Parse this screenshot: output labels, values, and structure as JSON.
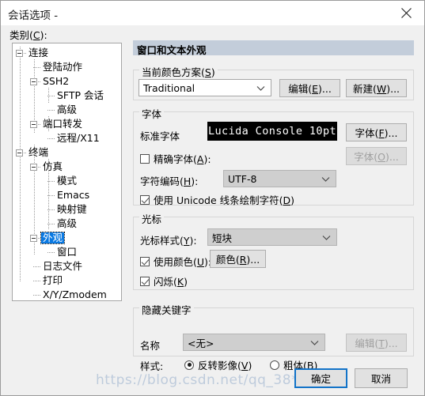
{
  "window": {
    "title": "会话选项 -",
    "close_icon": "close-icon"
  },
  "sidebar": {
    "label": "类别(C):",
    "label_main": "类别",
    "items": [
      {
        "label": "连接",
        "depth": 0,
        "expander": true,
        "selected": false
      },
      {
        "label": "登陆动作",
        "depth": 1,
        "expander": false,
        "selected": false
      },
      {
        "label": "SSH2",
        "depth": 1,
        "expander": true,
        "selected": false
      },
      {
        "label": "SFTP 会话",
        "depth": 2,
        "expander": false,
        "selected": false
      },
      {
        "label": "高级",
        "depth": 2,
        "expander": false,
        "selected": false
      },
      {
        "label": "端口转发",
        "depth": 1,
        "expander": true,
        "selected": false
      },
      {
        "label": "远程/X11",
        "depth": 2,
        "expander": false,
        "selected": false
      },
      {
        "label": "终端",
        "depth": 0,
        "expander": true,
        "selected": false
      },
      {
        "label": "仿真",
        "depth": 1,
        "expander": true,
        "selected": false
      },
      {
        "label": "模式",
        "depth": 2,
        "expander": false,
        "selected": false
      },
      {
        "label": "Emacs",
        "depth": 2,
        "expander": false,
        "selected": false
      },
      {
        "label": "映射键",
        "depth": 2,
        "expander": false,
        "selected": false
      },
      {
        "label": "高级",
        "depth": 2,
        "expander": false,
        "selected": false
      },
      {
        "label": "外观",
        "depth": 1,
        "expander": true,
        "selected": true
      },
      {
        "label": "窗口",
        "depth": 2,
        "expander": false,
        "selected": false
      },
      {
        "label": "日志文件",
        "depth": 1,
        "expander": false,
        "selected": false
      },
      {
        "label": "打印",
        "depth": 1,
        "expander": false,
        "selected": false
      },
      {
        "label": "X/Y/Zmodem",
        "depth": 1,
        "expander": false,
        "selected": false
      }
    ]
  },
  "main": {
    "header": "窗口和文本外观",
    "color_scheme": {
      "group_title": "当前颜色方案(S)",
      "selected": "Traditional",
      "edit_button": "编辑(E)...",
      "new_button": "新建(W)..."
    },
    "font": {
      "group_title": "字体",
      "standard_font_label": "标准字体",
      "standard_font_value": "Lucida Console 10pt",
      "font_button": "字体(F)...",
      "exact_font_label": "精确字体(A):",
      "exact_font_checked": false,
      "exact_font_button": "字体(O)...",
      "exact_font_button_disabled": true,
      "charset_label": "字符编码(H):",
      "charset_value": "UTF-8",
      "unicode_line_label": "使用 Unicode 线条绘制字符(D)",
      "unicode_line_checked": true
    },
    "cursor": {
      "group_title": "光标",
      "style_label": "光标样式(Y):",
      "style_value": "短块",
      "use_color_label": "使用颜色(U):",
      "use_color_checked": true,
      "color_button": "颜色(R)...",
      "blink_label": "闪烁(K)",
      "blink_checked": true
    },
    "hidden_keywords": {
      "group_title": "隐藏关键字",
      "name_label": "名称",
      "name_value": "<无>",
      "edit_button": "编辑(T)...",
      "edit_button_disabled": true,
      "style_label": "样式:",
      "option_invert": "反转影像(V)",
      "option_bold": "粗体(B)",
      "selected_option": "反转影像(V)"
    }
  },
  "footer": {
    "ok_button": "确定",
    "cancel_button": "取消"
  },
  "watermark": "https://blog.csdn.net/qq_38***582",
  "colors": {
    "header_bg": "#c3cdda",
    "selection": "#0a79e2",
    "default_button_border": "#1273c8",
    "dialog_bg": "#f0f0f0",
    "font_preview_bg": "#000000"
  }
}
